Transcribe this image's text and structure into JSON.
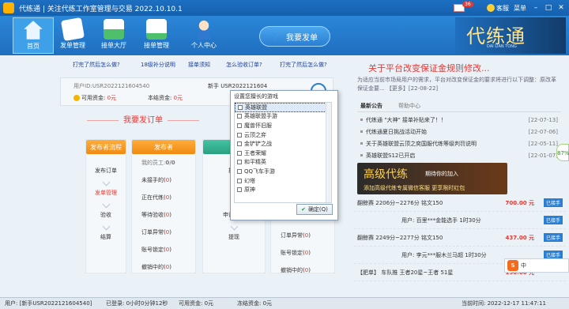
{
  "window": {
    "title": "代练通 | 关注代练工作室管理与交易 2022.10.10.1",
    "mail_count": "36",
    "kefu_label": "客服",
    "menu_label": "菜单"
  },
  "nav": {
    "items": [
      {
        "label": "首页",
        "icon": "home-icon"
      },
      {
        "label": "发单管理",
        "icon": "document-icon"
      },
      {
        "label": "接单大厅",
        "icon": "inbox-icon"
      },
      {
        "label": "接单管理",
        "icon": "clipboard-icon"
      },
      {
        "label": "个人中心",
        "icon": "user-icon"
      }
    ],
    "big_button": "我要发单",
    "brand_text": "代练通",
    "brand_sub": "DAI LIAN TONG"
  },
  "links": [
    "打完了然后怎么做?",
    "18级补分说明",
    "接单须知",
    "怎么验收订单?",
    "打完了然后怎么做?"
  ],
  "user": {
    "id_label": "用户ID:",
    "id_value": "USR2022121604540",
    "phone_label": "新手",
    "phone_value": "USR2022121604",
    "available_label": "可用资金:",
    "available_value": "0元",
    "settled_label": "本结资金:",
    "settled_value": "0元"
  },
  "section_title": "我要发订单",
  "publisher_flow": {
    "header": "发布者流程",
    "steps": [
      "发布订单",
      "发单管理",
      "验收",
      "结算"
    ]
  },
  "publisher": {
    "header": "发布者",
    "items": [
      {
        "label": "我的员工:",
        "value": "0/0"
      },
      {
        "label": "未接手的",
        "value": "0"
      },
      {
        "label": "正在代练",
        "value": "0"
      },
      {
        "label": "等待验收",
        "value": "0"
      },
      {
        "label": "订单异常",
        "value": "0"
      },
      {
        "label": "账号锁定",
        "value": "0"
      },
      {
        "label": "撤销中的",
        "value": "0"
      }
    ]
  },
  "taker_flow": {
    "header": "接",
    "steps": [
      "接手",
      "",
      "申请完单",
      "提现"
    ]
  },
  "taker_col": {
    "items": [
      {
        "label": "订单异常",
        "value": "0"
      },
      {
        "label": "账号锁定",
        "value": "0"
      },
      {
        "label": "撤销中的",
        "value": "0"
      }
    ]
  },
  "right": {
    "title": "关于平台改变保证金规则修改...",
    "desc": "为适应当前市场局用户的需求，平台对改变保证金的要求将进行以下调整：原改革保证金要... 【更多】[22-08-22]",
    "tabs": [
      "最新公告",
      "帮助中心"
    ],
    "news": [
      {
        "text": "代练通 \"大神\" 接单补贴来了！！",
        "date": "[22-07-13]"
      },
      {
        "text": "代练通夏日挑战活动开始",
        "date": "[22-07-06]"
      },
      {
        "text": "关于英雄联盟云顶之奕国服代练等级判罚说明",
        "date": "[22-05-11]"
      },
      {
        "text": "英雄联盟S12已开启",
        "date": "[22-01-07]"
      }
    ],
    "banner": {
      "title": "高级代练",
      "tagline": "期待你的加入",
      "sub": "添加高级代练专属微信客服 更享限时红包"
    },
    "orders": [
      {
        "game": "翻鲸赛",
        "text": "2206分~2276分 铭文150",
        "price": "700.00 元",
        "tag": "已接手"
      },
      {
        "game": "",
        "text": "用户: 百里***金能选手 1时30分",
        "price": "",
        "tag": "已接手"
      },
      {
        "game": "翻鲸赛",
        "text": "2249分~2277分 铭文150",
        "price": "437.00 元",
        "tag": "已接手"
      },
      {
        "game": "",
        "text": "用户: 李元***服木兰马超 1时30分",
        "price": "",
        "tag": "已接手"
      },
      {
        "game": "【肥单】",
        "text": "车队推 王者20星~王者 51星",
        "price": "150.00 元",
        "tag": ""
      }
    ]
  },
  "modal": {
    "title": "设置您擅长的游戏",
    "options": [
      "英雄联盟",
      "英雄联盟手游",
      "魔兽怀旧服",
      "云顶之弈",
      "金铲铲之战",
      "王者荣耀",
      "和平精英",
      "QQ飞车手游",
      "幻塔",
      "原神"
    ],
    "ok_label": "确定(Q)"
  },
  "side_widget": "87%",
  "ime": {
    "logo": "S",
    "label": "中"
  },
  "statusbar": {
    "user": "用户: [新手USR2022121604540]",
    "online": "已登录: 0小时0分钟12秒",
    "available": "可用资金: 0元",
    "frozen": "冻结资金: 0元",
    "time": "当前时间: 2022-12-17 11:47:11"
  }
}
